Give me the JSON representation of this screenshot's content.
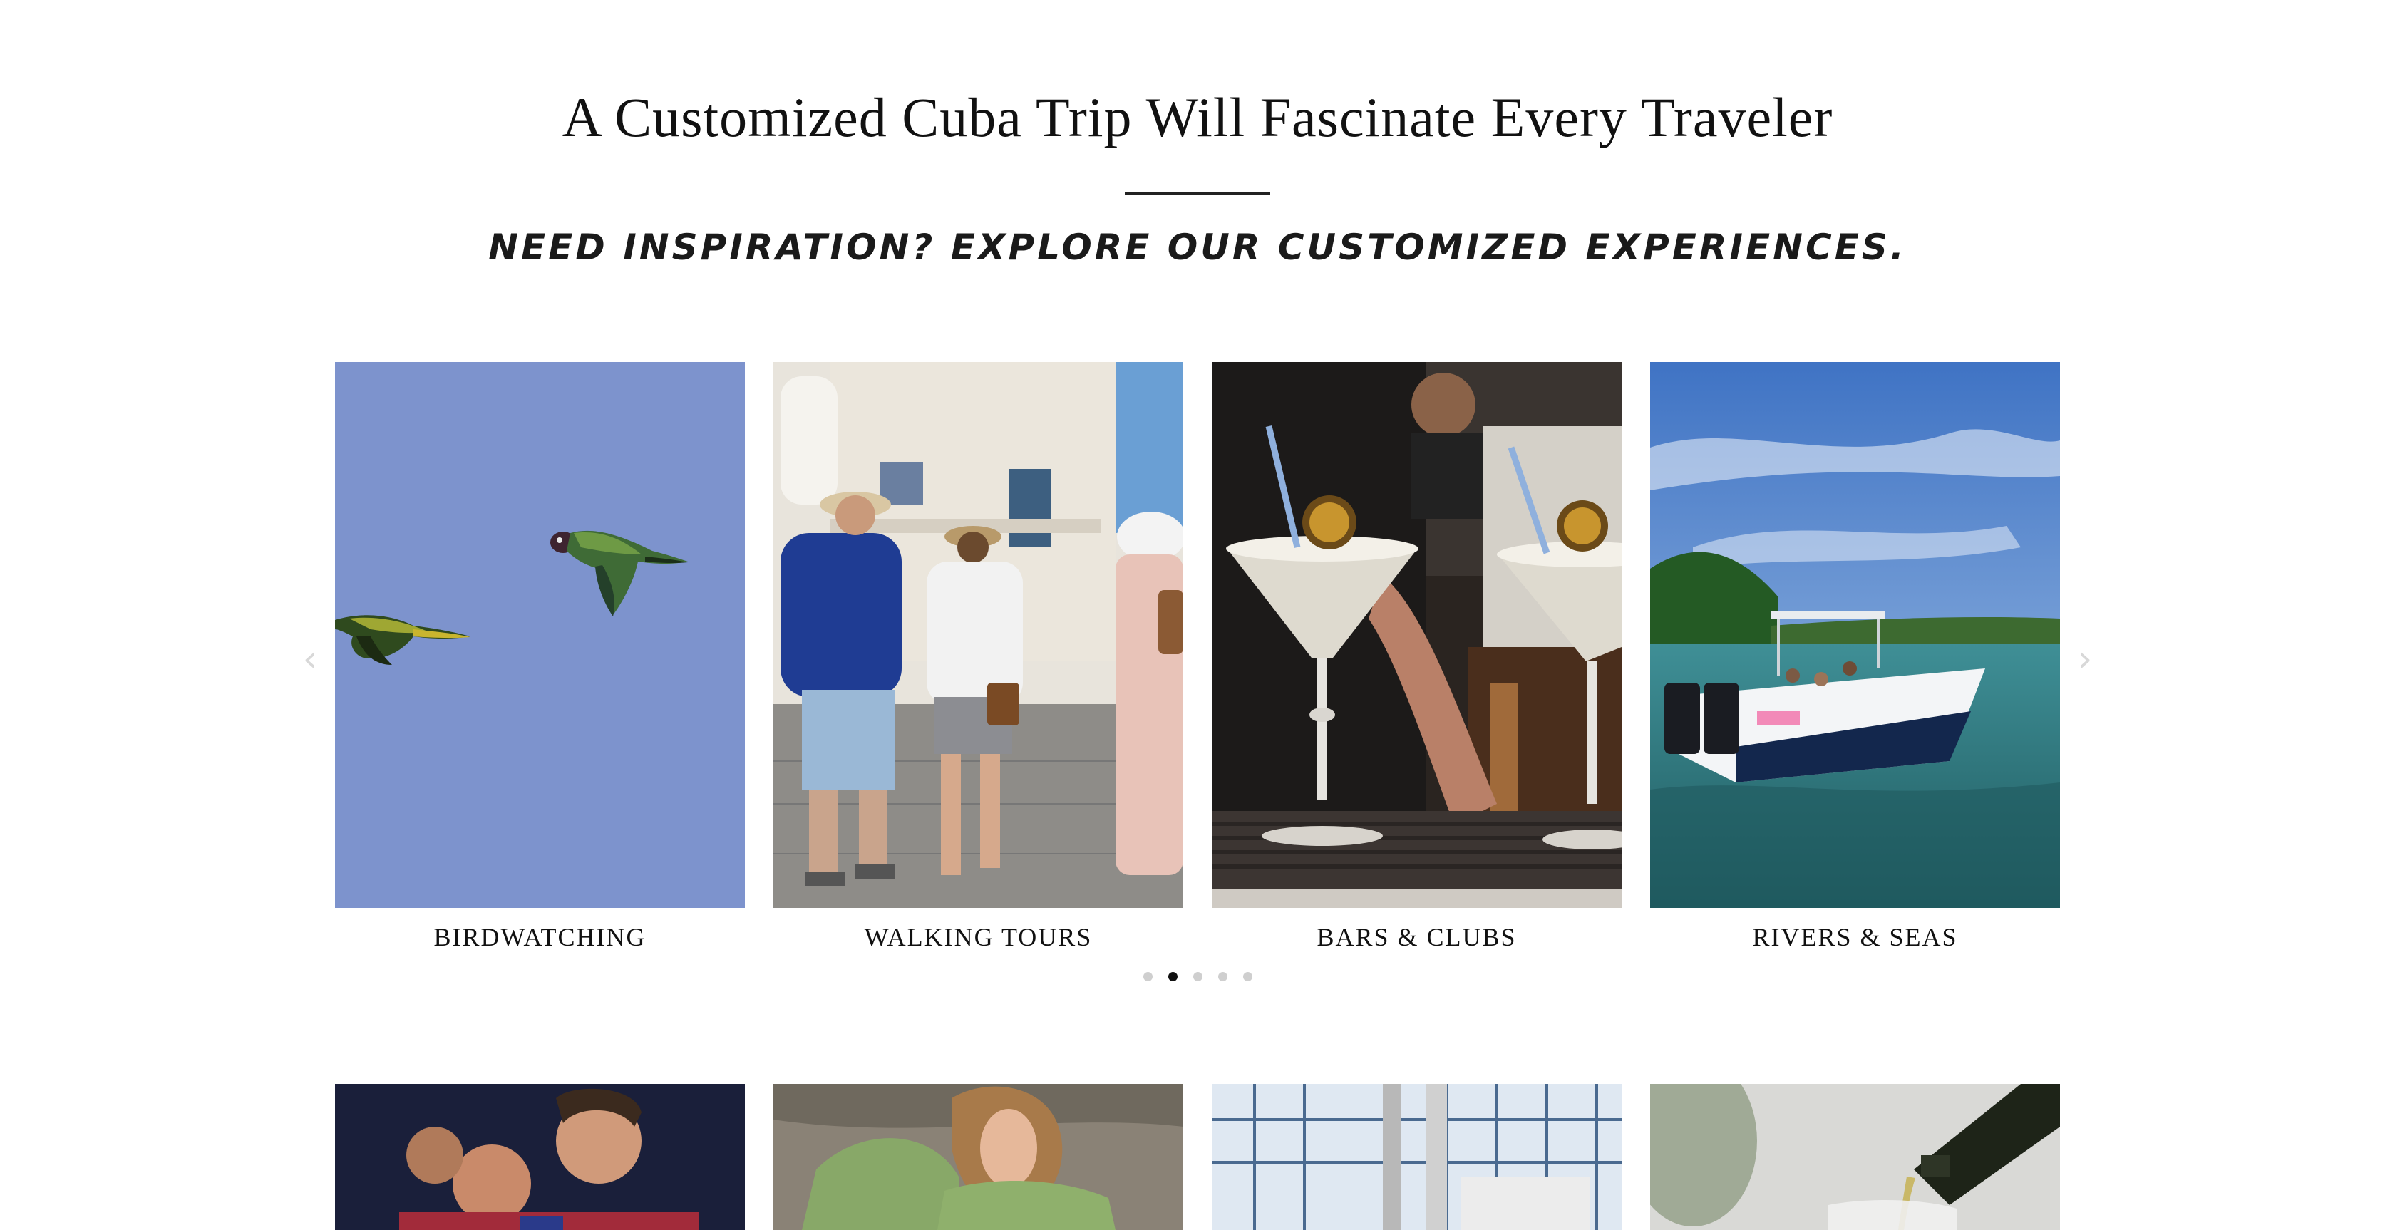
{
  "section": {
    "title": "A Customized Cuba Trip Will Fascinate Every Traveler",
    "subtitle": "NEED INSPIRATION? EXPLORE OUR CUSTOMIZED EXPERIENCES."
  },
  "carousel": {
    "prev_icon": "chevron-left-icon",
    "next_icon": "chevron-right-icon",
    "prev_glyph": "‹",
    "next_glyph": "›",
    "slides": [
      {
        "label": "BIRDWATCHING",
        "image": "parrots-flying-blue-sky"
      },
      {
        "label": "WALKING TOURS",
        "image": "people-walking-old-havana-street"
      },
      {
        "label": "BARS & CLUBS",
        "image": "frozen-daiquiri-cocktails-bar"
      },
      {
        "label": "RIVERS & SEAS",
        "image": "speedboat-on-turquoise-sea"
      }
    ],
    "pagination": {
      "total": 5,
      "active": 2
    }
  },
  "next_row": [
    {
      "image": "soccer-players-celebrating"
    },
    {
      "image": "woman-in-green-dress"
    },
    {
      "image": "modern-interior-windows"
    },
    {
      "image": "pouring-wine-bottle"
    }
  ],
  "colors": {
    "sky_blue": "#7d93cd",
    "text": "#111111",
    "dot_inactive": "#cfcfcf",
    "dot_active": "#111111",
    "arrow": "#d8d8d8"
  }
}
